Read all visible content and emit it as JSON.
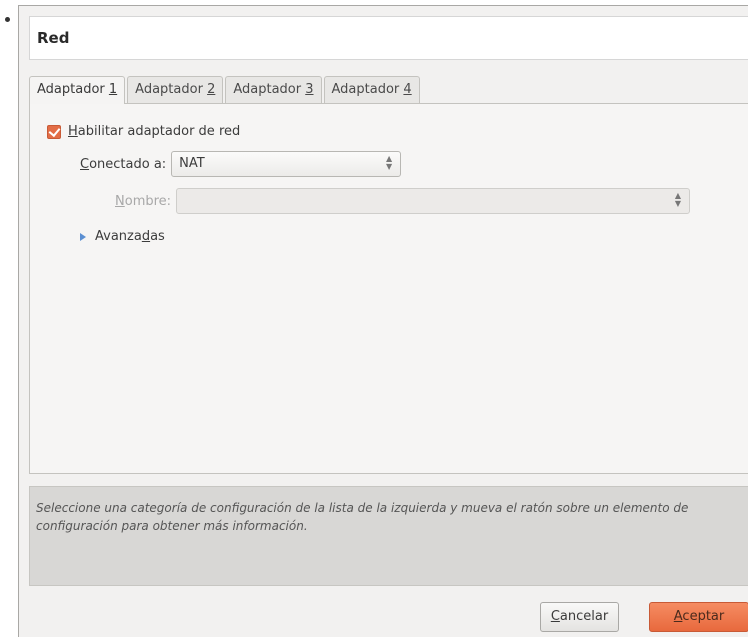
{
  "dialog": {
    "title": "Red",
    "tabs": [
      {
        "label": "Adaptador ",
        "mnemonic": "1"
      },
      {
        "label": "Adaptador ",
        "mnemonic": "2"
      },
      {
        "label": "Adaptador ",
        "mnemonic": "3"
      },
      {
        "label": "Adaptador ",
        "mnemonic": "4"
      }
    ],
    "enable_checkbox": {
      "mnemonic": "H",
      "label_rest": "abilitar adaptador de red",
      "checked": true
    },
    "connected": {
      "mnemonic": "C",
      "label_rest": "onectado a:",
      "value": "NAT"
    },
    "name": {
      "mnemonic": "N",
      "label_rest": "ombre:",
      "value": ""
    },
    "advanced": {
      "label_start": "Avanza",
      "mnemonic": "d",
      "label_end": "as"
    },
    "info_text": "Seleccione una categoría de configuración de la lista de la izquierda y mueva el ratón sobre un elemento de configuración para obtener más información.",
    "buttons": {
      "cancel": {
        "mnemonic": "C",
        "label_rest": "ancelar"
      },
      "ok": {
        "mnemonic": "A",
        "label_rest": "ceptar"
      }
    }
  },
  "colors": {
    "accent": "#e8693d",
    "checkbox": "#e36d46",
    "expander": "#5b8fd2"
  }
}
